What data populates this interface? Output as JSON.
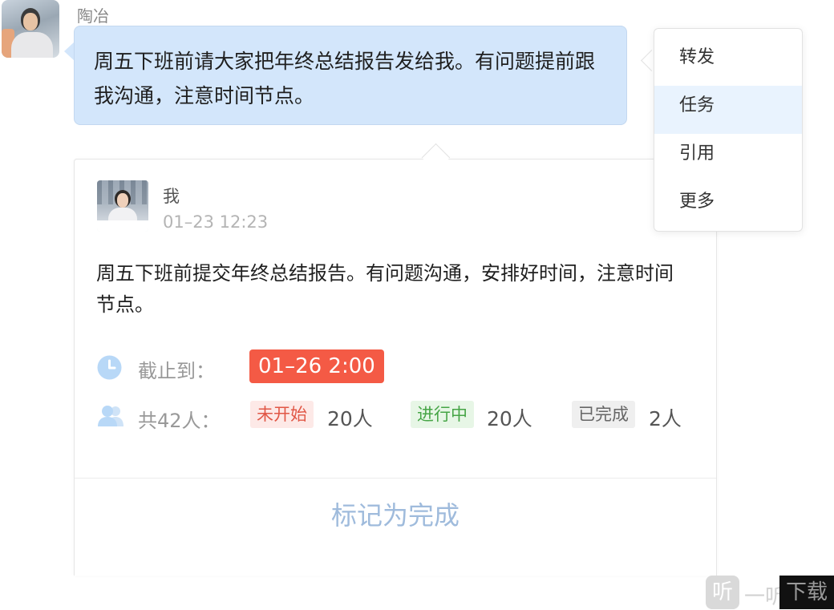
{
  "message": {
    "sender_name": "陶冶",
    "text": "周五下班前请大家把年终总结报告发给我。有问题提前跟我沟通，注意时间节点。"
  },
  "context_menu": {
    "items": [
      {
        "label": "转发",
        "active": false
      },
      {
        "label": "任务",
        "active": true
      },
      {
        "label": "引用",
        "active": false
      },
      {
        "label": "更多",
        "active": false
      }
    ]
  },
  "task_card": {
    "author_name": "我",
    "timestamp": "01–23 12:23",
    "text": "周五下班前提交年终总结报告。有问题沟通，安排好时间，注意时间节点。",
    "deadline_label": "截止到：",
    "deadline_value": "01–26 2:00",
    "total_label": "共42人：",
    "statuses": [
      {
        "label": "未开始",
        "count": "20人"
      },
      {
        "label": "进行中",
        "count": "20人"
      },
      {
        "label": "已完成",
        "count": "2人"
      }
    ],
    "complete_button_label": "标记为完成"
  },
  "watermark": {
    "icon_char": "听",
    "text_a": "一听",
    "text_b": "下载"
  },
  "icons": {
    "deadline": "clock-icon",
    "participants": "people-icon"
  },
  "colors": {
    "bubble": "#d3e6fb",
    "deadline_badge": "#f45a45",
    "not_started": "#e15746",
    "in_progress": "#46a546",
    "complete_button": "#9fbbdc",
    "menu_active": "#e9f3fe"
  }
}
